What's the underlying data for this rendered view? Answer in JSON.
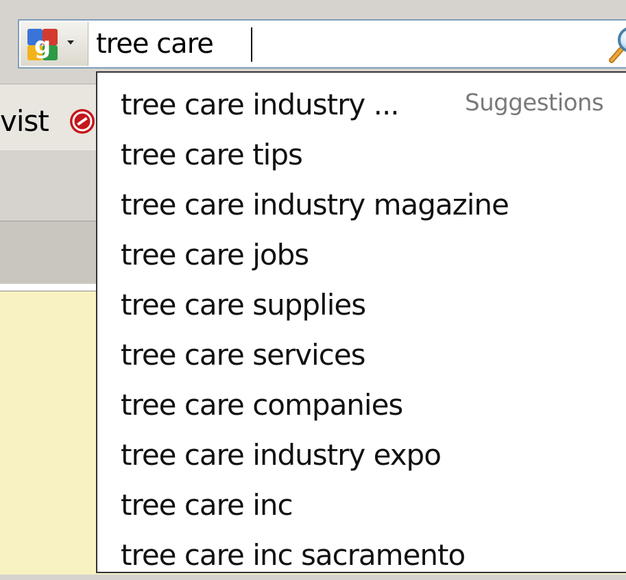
{
  "search": {
    "query": "tree care",
    "engine_icon": "google-logo-icon",
    "go_icon": "magnifier-icon"
  },
  "bookmarks": {
    "partial_label": "vist",
    "icon": "red-circle-icon"
  },
  "suggestions": {
    "header": "Suggestions",
    "items": [
      "tree care industry ...",
      "tree care tips",
      "tree care industry magazine",
      "tree care jobs",
      "tree care supplies",
      "tree care services",
      "tree care companies",
      "tree care industry expo",
      "tree care inc",
      "tree care inc sacramento"
    ]
  },
  "colors": {
    "content_bg": "#f8f2c2",
    "toolbar_bg": "#d6d3ce",
    "header_text": "#7a7a7a"
  }
}
